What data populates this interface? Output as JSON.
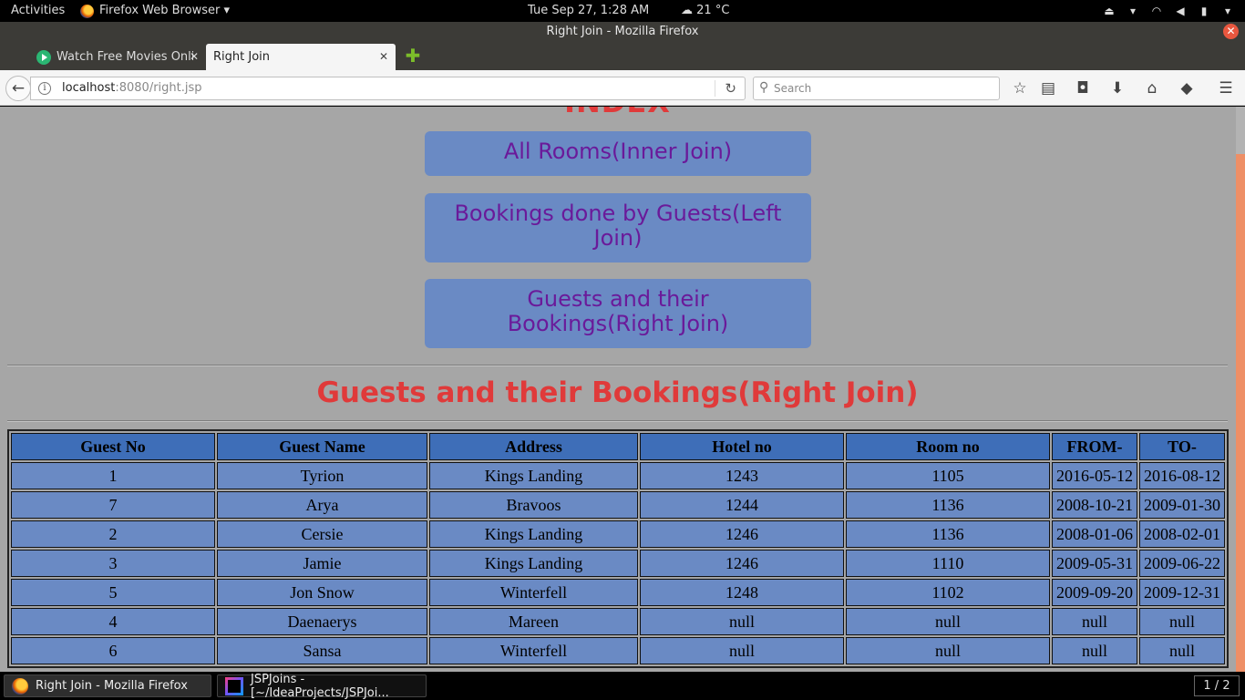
{
  "topbar": {
    "activities": "Activities",
    "app_menu": "Firefox Web Browser ▾",
    "clock": "Tue Sep 27,  1:28 AM",
    "weather": "21 °C"
  },
  "window": {
    "title": "Right Join - Mozilla Firefox"
  },
  "tabs": [
    {
      "label": "Watch Free Movies Onli..."
    },
    {
      "label": "Right Join"
    }
  ],
  "navbar": {
    "url_host": "localhost",
    "url_rest": ":8080/right.jsp",
    "search_placeholder": "Search"
  },
  "page": {
    "index_heading": "INDEX",
    "buttons": [
      "All Rooms(Inner Join)",
      "Bookings done by Guests(Left Join)",
      "Guests and their Bookings(Right Join)"
    ],
    "section_title": "Guests and their Bookings(Right Join)",
    "table": {
      "headers": [
        "Guest No",
        "Guest Name",
        "Address",
        "Hotel no",
        "Room no",
        "FROM-",
        "TO-"
      ],
      "rows": [
        [
          "1",
          "Tyrion",
          "Kings Landing",
          "1243",
          "1105",
          "2016-05-12",
          "2016-08-12"
        ],
        [
          "7",
          "Arya",
          "Bravoos",
          "1244",
          "1136",
          "2008-10-21",
          "2009-01-30"
        ],
        [
          "2",
          "Cersie",
          "Kings Landing",
          "1246",
          "1136",
          "2008-01-06",
          "2008-02-01"
        ],
        [
          "3",
          "Jamie",
          "Kings Landing",
          "1246",
          "1110",
          "2009-05-31",
          "2009-06-22"
        ],
        [
          "5",
          "Jon Snow",
          "Winterfell",
          "1248",
          "1102",
          "2009-09-20",
          "2009-12-31"
        ],
        [
          "4",
          "Daenaerys",
          "Mareen",
          "null",
          "null",
          "null",
          "null"
        ],
        [
          "6",
          "Sansa",
          "Winterfell",
          "null",
          "null",
          "null",
          "null"
        ]
      ]
    }
  },
  "taskbar": {
    "items": [
      "Right Join - Mozilla Firefox",
      "JSPJoins - [~/IdeaProjects/JSPJoi..."
    ],
    "workspace": "1 / 2"
  },
  "colors": {
    "heading_red": "#e03a3a",
    "button_bg": "#6a8ac4",
    "button_text": "#6a1a9a",
    "table_header_bg": "#3e6eb8",
    "page_bg": "#a6a6a6",
    "scrollbar_thumb": "#ee8f66"
  },
  "icons": [
    "firefox-icon",
    "play-icon",
    "close-icon",
    "new-tab-icon",
    "back-icon",
    "info-icon",
    "reload-icon",
    "search-icon",
    "bookmark-star-icon",
    "reading-list-icon",
    "pocket-icon",
    "download-icon",
    "home-icon",
    "sync-icon",
    "menu-icon",
    "intellij-icon"
  ]
}
